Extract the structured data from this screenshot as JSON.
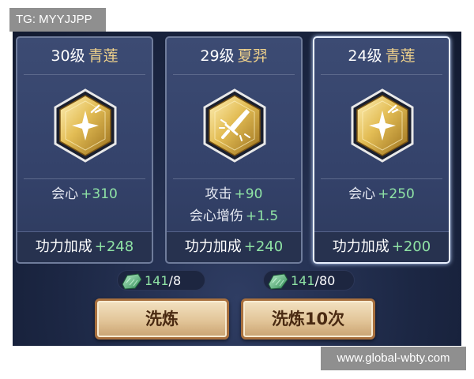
{
  "watermarks": {
    "top_left": "TG: MYYJJPP",
    "bottom_right": "www.global-wbty.com"
  },
  "cards": [
    {
      "level": "30级",
      "name": "青莲",
      "stats": [
        {
          "label": "会心",
          "value": "+310"
        }
      ],
      "footer": {
        "label": "功力加成",
        "value": "+248"
      },
      "selected": false,
      "icon": "sparkle-emblem-icon"
    },
    {
      "level": "29级",
      "name": "夏羿",
      "stats": [
        {
          "label": "攻击",
          "value": "+90"
        },
        {
          "label": "会心增伤",
          "value": "+1.5"
        }
      ],
      "footer": {
        "label": "功力加成",
        "value": "+240"
      },
      "selected": false,
      "icon": "sword-emblem-icon"
    },
    {
      "level": "24级",
      "name": "青莲",
      "stats": [
        {
          "label": "会心",
          "value": "+250"
        }
      ],
      "footer": {
        "label": "功力加成",
        "value": "+200"
      },
      "selected": true,
      "icon": "sparkle-emblem-icon"
    }
  ],
  "costs": [
    {
      "have": "141",
      "need": "/8",
      "icon": "jade-stone-icon"
    },
    {
      "have": "141",
      "need": "/80",
      "icon": "jade-stone-icon"
    }
  ],
  "buttons": {
    "refine_once": "洗炼",
    "refine_ten": "洗炼10次"
  },
  "colors": {
    "accent_green": "#8fe3a5",
    "title_gold": "#f0d28b",
    "button_text": "#4a2a12"
  }
}
